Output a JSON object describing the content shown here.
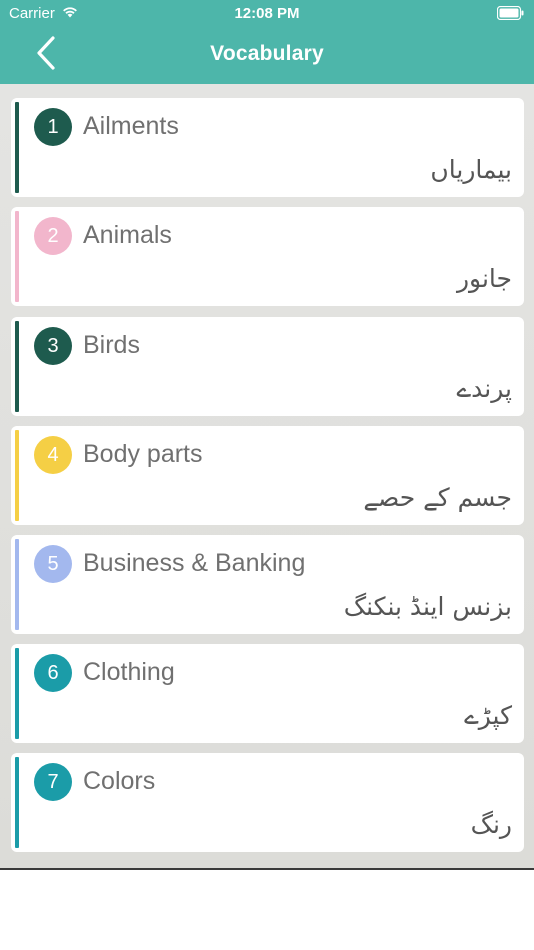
{
  "status_bar": {
    "carrier": "Carrier",
    "time": "12:08 PM"
  },
  "nav": {
    "title": "Vocabulary",
    "back_icon": "chevron-left-icon"
  },
  "theme": {
    "header_color": "#4db6aa"
  },
  "categories": [
    {
      "number": "1",
      "title": "Ailments",
      "urdu": "بیماریاں",
      "color": "#1e5b4e"
    },
    {
      "number": "2",
      "title": "Animals",
      "urdu": "جانور",
      "color": "#f2b6cc"
    },
    {
      "number": "3",
      "title": "Birds",
      "urdu": "پرندے",
      "color": "#1e5b4e"
    },
    {
      "number": "4",
      "title": "Body parts",
      "urdu": "جسم کے حصے",
      "color": "#f5cf45"
    },
    {
      "number": "5",
      "title": "Business & Banking",
      "urdu": "بزنس اینڈ بنکنگ",
      "color": "#a3b8ee"
    },
    {
      "number": "6",
      "title": "Clothing",
      "urdu": "کپڑے",
      "color": "#1b9ca8"
    },
    {
      "number": "7",
      "title": "Colors",
      "urdu": "رنگ",
      "color": "#1b9ca8"
    }
  ]
}
